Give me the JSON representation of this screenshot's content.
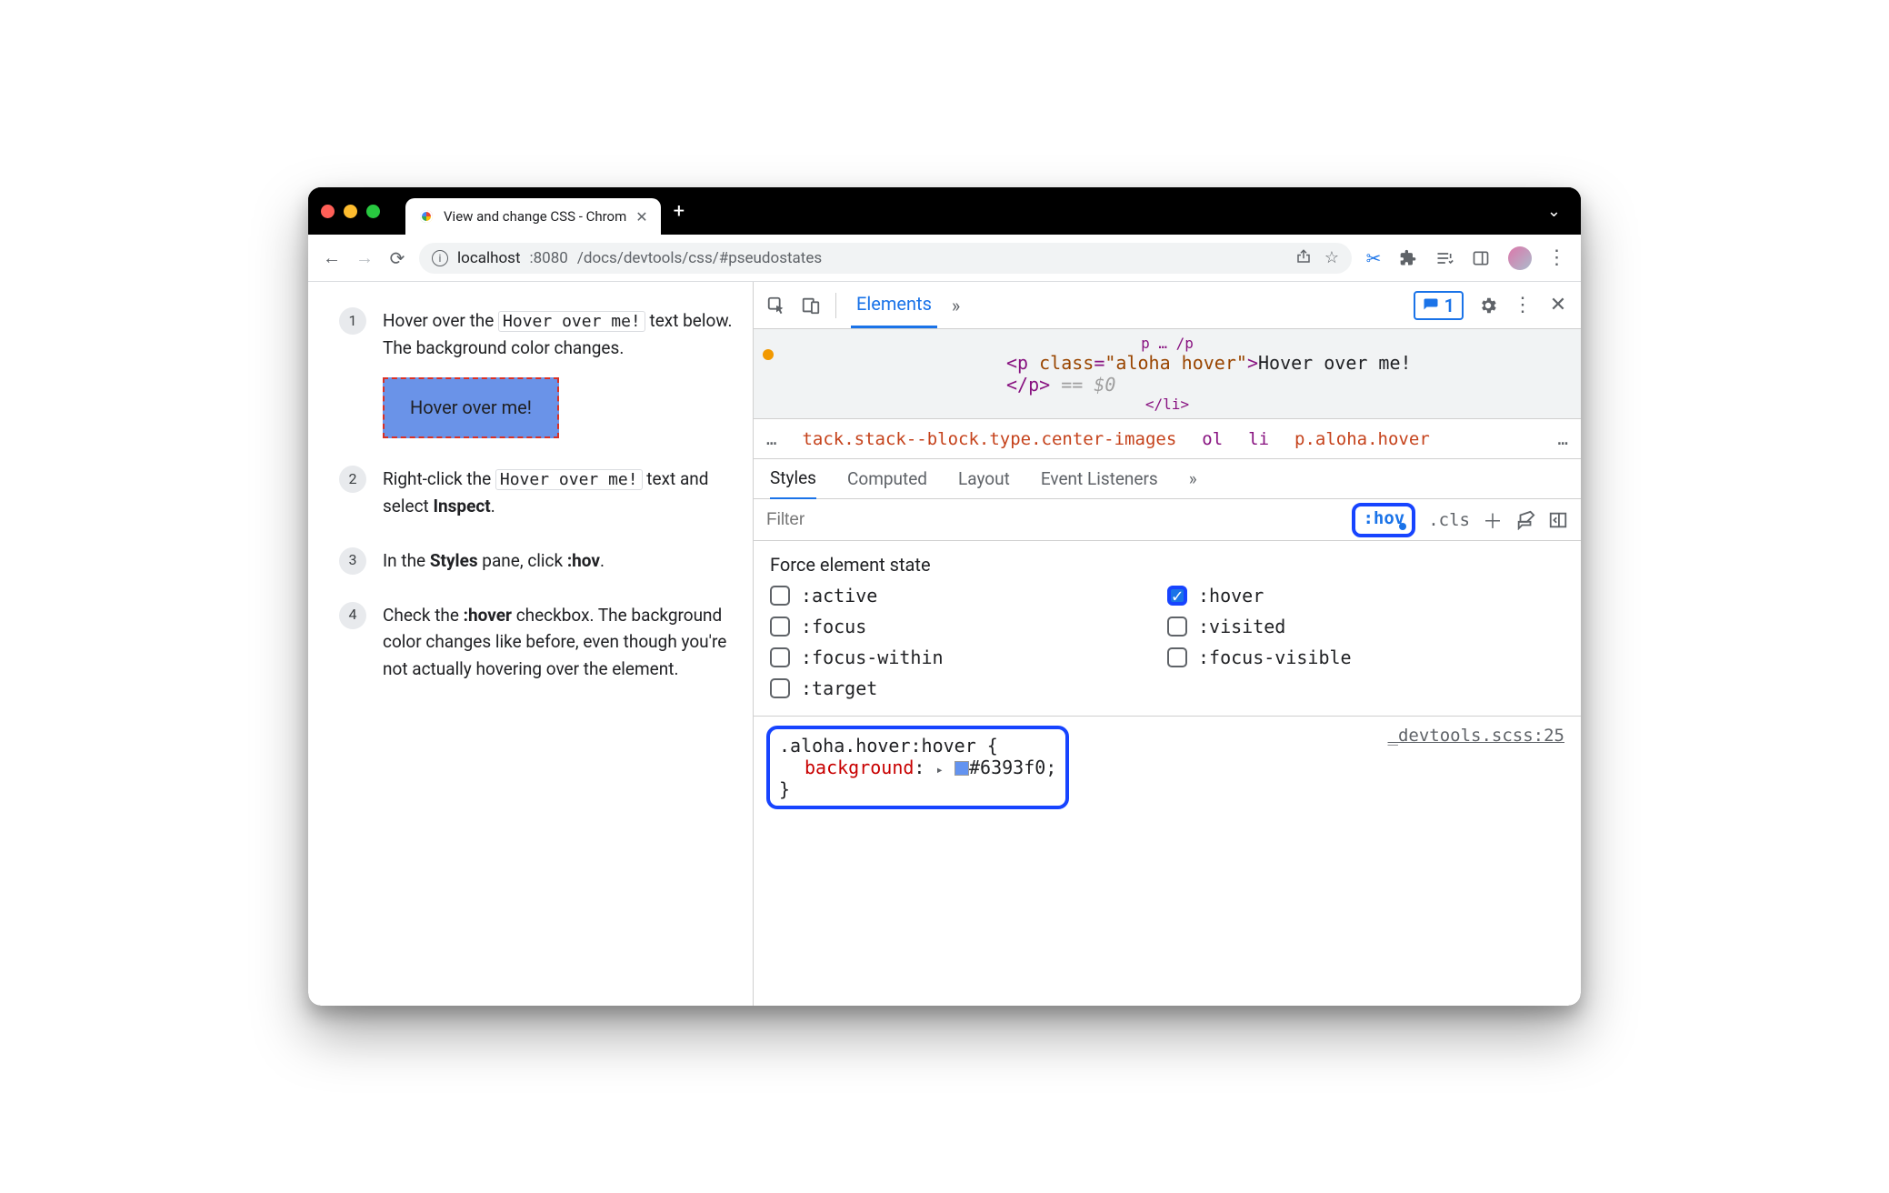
{
  "window": {
    "tab_title": "View and change CSS - Chrom",
    "url_host": "localhost",
    "url_port": ":8080",
    "url_path": "/docs/devtools/css/#pseudostates"
  },
  "page": {
    "steps": [
      {
        "pre": "Hover over the ",
        "code": "Hover over me!",
        "post": " text below. The background color changes."
      },
      {
        "pre": "Right-click the ",
        "code": "Hover over me!",
        "post_a": " text and select ",
        "bold": "Inspect",
        "post_b": "."
      },
      {
        "pre": "In the ",
        "bold": "Styles",
        "mid": " pane, click ",
        "bold2": ":hov",
        "post": "."
      },
      {
        "pre": "Check the ",
        "bold": ":hover",
        "post": " checkbox. The background color changes like before, even though you're not actually hovering over the element."
      }
    ],
    "hover_box_text": "Hover over me!"
  },
  "devtools": {
    "tabs": {
      "elements": "Elements"
    },
    "issue_count": "1",
    "dom": {
      "gray_above": "p … /p",
      "tag_open_1": "<p ",
      "attr_name": "class",
      "attr_val": "\"aloha hover\"",
      "text_content": "Hover over me!",
      "tag_close": "</p>",
      "eq": "== $0",
      "gray_below": "</li>"
    },
    "crumbs": {
      "ellipsis": "…",
      "c1": "tack.stack--block.type.center-images",
      "c2": "ol",
      "c3": "li",
      "c4": "p.aloha.hover",
      "end": "…"
    },
    "subtabs": [
      "Styles",
      "Computed",
      "Layout",
      "Event Listeners"
    ],
    "filter_placeholder": "Filter",
    "tools": {
      "hov": ":hov",
      "cls": ".cls"
    },
    "force_state": {
      "title": "Force element state",
      "states": [
        {
          "label": ":active",
          "checked": false
        },
        {
          "label": ":hover",
          "checked": true
        },
        {
          "label": ":focus",
          "checked": false
        },
        {
          "label": ":visited",
          "checked": false
        },
        {
          "label": ":focus-within",
          "checked": false
        },
        {
          "label": ":focus-visible",
          "checked": false
        },
        {
          "label": ":target",
          "checked": false
        }
      ]
    },
    "rule": {
      "selector": ".aloha.hover:hover {",
      "prop": "background",
      "value": "#6393f0",
      "close": "}",
      "source": "_devtools.scss:25"
    }
  }
}
